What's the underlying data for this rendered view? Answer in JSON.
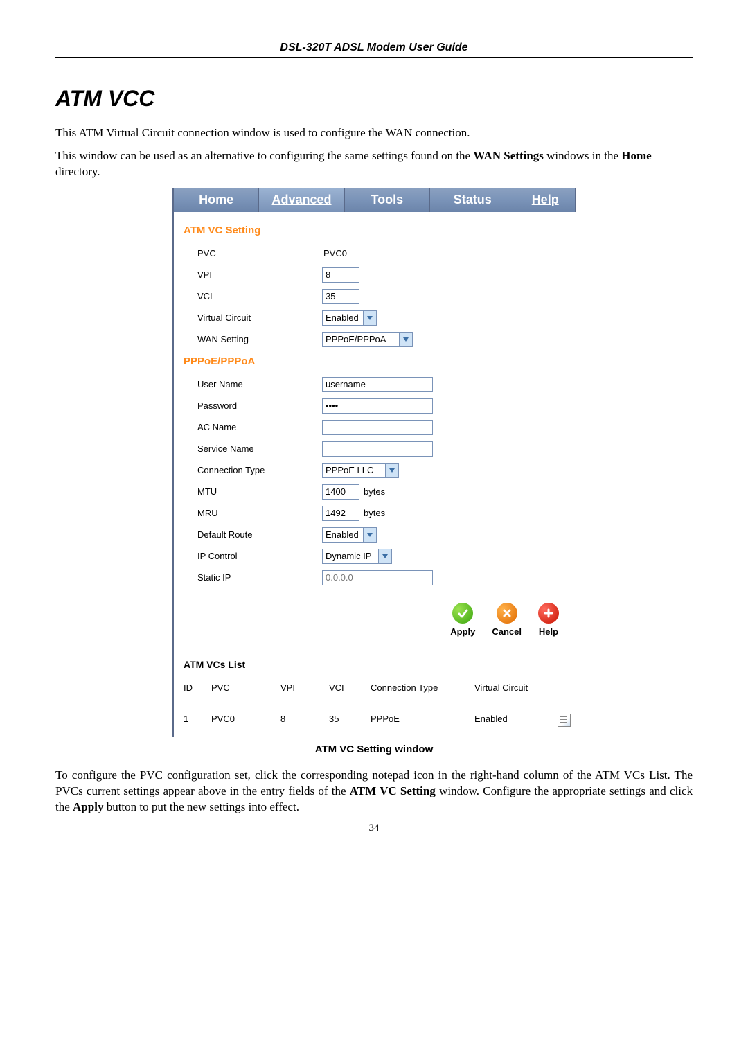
{
  "doc_header": "DSL-320T ADSL Modem User Guide",
  "page_title": "ATM VCC",
  "intro_1": "This ATM Virtual Circuit connection window is used to configure the WAN connection.",
  "intro_2_a": "This window can be used as an alternative to configuring the same settings found on the ",
  "intro_2_bold_1": "WAN Settings",
  "intro_2_b": " windows in the ",
  "intro_2_bold_2": "Home",
  "intro_2_c": " directory.",
  "tabs": {
    "home": "Home",
    "advanced": "Advanced",
    "tools": "Tools",
    "status": "Status",
    "help": "Help"
  },
  "atm_section": {
    "heading": "ATM VC Setting",
    "pvc_label": "PVC",
    "pvc_value": "PVC0",
    "vpi_label": "VPI",
    "vpi_value": "8",
    "vci_label": "VCI",
    "vci_value": "35",
    "vc_label": "Virtual Circuit",
    "vc_value": "Enabled",
    "wan_label": "WAN Setting",
    "wan_value": "PPPoE/PPPoA"
  },
  "ppp_section": {
    "heading": "PPPoE/PPPoA",
    "username_label": "User Name",
    "username_value": "username",
    "password_label": "Password",
    "password_value": "••••",
    "acname_label": "AC Name",
    "acname_value": "",
    "service_label": "Service Name",
    "service_value": "",
    "conn_label": "Connection Type",
    "conn_value": "PPPoE LLC",
    "mtu_label": "MTU",
    "mtu_value": "1400",
    "mtu_unit": "bytes",
    "mru_label": "MRU",
    "mru_value": "1492",
    "mru_unit": "bytes",
    "route_label": "Default Route",
    "route_value": "Enabled",
    "ipctrl_label": "IP Control",
    "ipctrl_value": "Dynamic IP",
    "static_label": "Static IP",
    "static_placeholder": "0.0.0.0"
  },
  "actions": {
    "apply": "Apply",
    "cancel": "Cancel",
    "help": "Help"
  },
  "vcs_list": {
    "heading": "ATM VCs List",
    "headers": {
      "id": "ID",
      "pvc": "PVC",
      "vpi": "VPI",
      "vci": "VCI",
      "conn": "Connection Type",
      "vc": "Virtual Circuit"
    },
    "row": {
      "id": "1",
      "pvc": "PVC0",
      "vpi": "8",
      "vci": "35",
      "conn": "PPPoE",
      "vc": "Enabled"
    }
  },
  "caption": "ATM VC Setting window",
  "outro_a": "To configure the PVC configuration set, click the corresponding notepad icon in the right-hand column of the ATM VCs List. The PVCs current settings appear above in the entry fields of the ",
  "outro_bold_1": "ATM VC Setting",
  "outro_b": " window. Configure the appropriate settings and click the ",
  "outro_bold_2": "Apply",
  "outro_c": " button to put the new settings into effect.",
  "page_number": "34"
}
